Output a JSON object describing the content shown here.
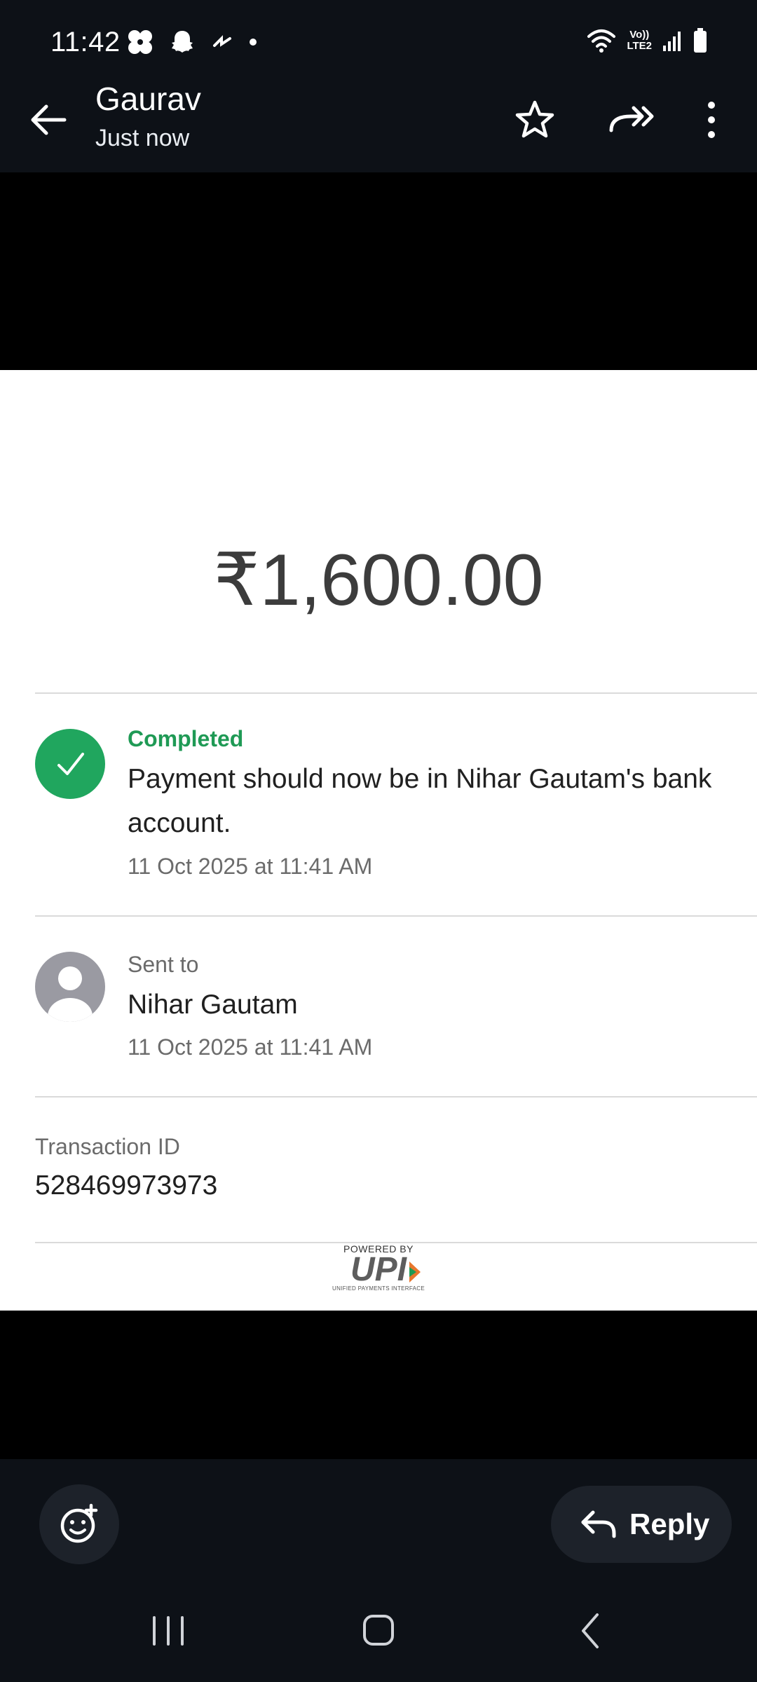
{
  "status_bar": {
    "time": "11:42",
    "lte": "Vo))\nLTE2",
    "notif_icons": [
      "pinwheel-icon",
      "snapchat-icon",
      "swipe-icon",
      "dot-icon"
    ]
  },
  "header": {
    "title": "Gaurav",
    "subtitle": "Just now"
  },
  "receipt": {
    "amount": "₹1,600.00",
    "status_label": "Completed",
    "status_desc": "Payment should now be in Nihar Gautam's bank account.",
    "status_time": "11 Oct 2025 at 11:41 AM",
    "sent_label": "Sent to",
    "sent_name": "Nihar Gautam",
    "sent_time": "11 Oct 2025 at 11:41 AM",
    "txn_label": "Transaction ID",
    "txn_id": "528469973973",
    "upi_powered": "POWERED BY",
    "upi_word": "UPI",
    "upi_sub": "UNIFIED PAYMENTS INTERFACE"
  },
  "bottom": {
    "reply_label": "Reply"
  },
  "colors": {
    "status_green": "#20a65e",
    "dark_bg": "#0d1117"
  }
}
